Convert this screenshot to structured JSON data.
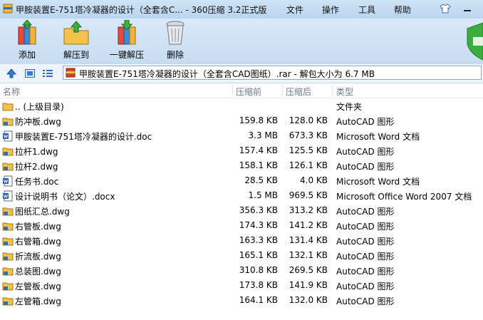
{
  "window": {
    "title": "甲胺装置E-751塔冷凝器的设计（全套含C... - 360压缩 3.2正式版",
    "menu": [
      "文件",
      "操作",
      "工具",
      "帮助"
    ]
  },
  "toolbar": {
    "buttons": [
      {
        "label": "添加",
        "icon": "add-books-icon"
      },
      {
        "label": "解压到",
        "icon": "extract-folder-icon"
      },
      {
        "label": "一键解压",
        "icon": "one-click-extract-icon"
      },
      {
        "label": "删除",
        "icon": "trash-can-icon"
      }
    ]
  },
  "address": {
    "path": "甲胺装置E-751塔冷凝器的设计（全套含CAD图纸）.rar - 解包大小为 6.7 MB"
  },
  "columns": {
    "name": "名称",
    "size": "压缩前",
    "packed": "压缩后",
    "type": "类型"
  },
  "files": [
    {
      "name": ".. (上级目录)",
      "size": "",
      "packed": "",
      "type": "文件夹",
      "icon": "folder-icon"
    },
    {
      "name": "防冲板.dwg",
      "size": "159.8 KB",
      "packed": "128.0 KB",
      "type": "AutoCAD 图形",
      "icon": "dwg-file-icon"
    },
    {
      "name": "甲胺装置E-751塔冷凝器的设计.doc",
      "size": "3.3 MB",
      "packed": "673.3 KB",
      "type": "Microsoft Word 文档",
      "icon": "word-file-icon"
    },
    {
      "name": "拉杆1.dwg",
      "size": "157.4 KB",
      "packed": "125.5 KB",
      "type": "AutoCAD 图形",
      "icon": "dwg-file-icon"
    },
    {
      "name": "拉杆2.dwg",
      "size": "158.1 KB",
      "packed": "126.1 KB",
      "type": "AutoCAD 图形",
      "icon": "dwg-file-icon"
    },
    {
      "name": "任务书.doc",
      "size": "28.5 KB",
      "packed": "4.0 KB",
      "type": "Microsoft Word 文档",
      "icon": "word-file-icon"
    },
    {
      "name": "设计说明书（论文）.docx",
      "size": "1.5 MB",
      "packed": "969.5 KB",
      "type": "Microsoft Office Word 2007 文档",
      "icon": "word-file-icon"
    },
    {
      "name": "图纸汇总.dwg",
      "size": "356.3 KB",
      "packed": "313.2 KB",
      "type": "AutoCAD 图形",
      "icon": "dwg-file-icon"
    },
    {
      "name": "右管板.dwg",
      "size": "174.3 KB",
      "packed": "141.2 KB",
      "type": "AutoCAD 图形",
      "icon": "dwg-file-icon"
    },
    {
      "name": "右管箱.dwg",
      "size": "163.3 KB",
      "packed": "131.4 KB",
      "type": "AutoCAD 图形",
      "icon": "dwg-file-icon"
    },
    {
      "name": "折流板.dwg",
      "size": "165.1 KB",
      "packed": "132.1 KB",
      "type": "AutoCAD 图形",
      "icon": "dwg-file-icon"
    },
    {
      "name": "总装图.dwg",
      "size": "310.8 KB",
      "packed": "269.5 KB",
      "type": "AutoCAD 图形",
      "icon": "dwg-file-icon"
    },
    {
      "name": "左管板.dwg",
      "size": "173.8 KB",
      "packed": "141.9 KB",
      "type": "AutoCAD 图形",
      "icon": "dwg-file-icon"
    },
    {
      "name": "左管箱.dwg",
      "size": "164.1 KB",
      "packed": "132.0 KB",
      "type": "AutoCAD 图形",
      "icon": "dwg-file-icon"
    }
  ],
  "colors": {
    "toolbar_top": "#d9e9f8",
    "accent_blue": "#1e74c9",
    "guard_green": "#3cae3f"
  }
}
